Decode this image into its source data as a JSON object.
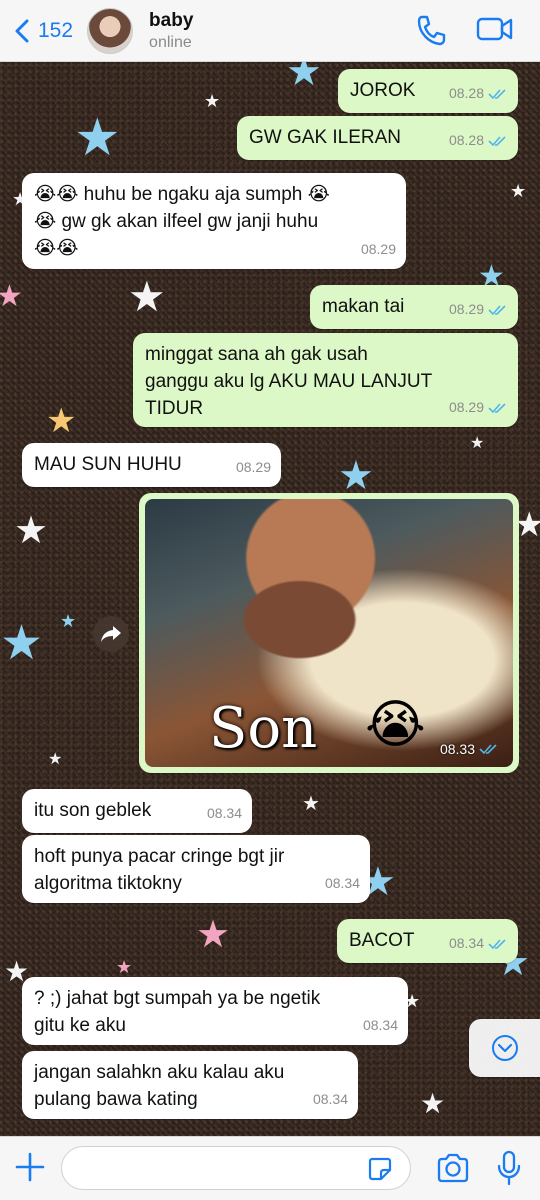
{
  "header": {
    "back_count": "152",
    "contact_name": "baby",
    "contact_status": "online"
  },
  "colors": {
    "accent": "#1a7cf0",
    "outgoing_bubble": "#dcf8c6",
    "incoming_bubble": "#ffffff",
    "read_ticks": "#4fb6ec"
  },
  "messages": [
    {
      "dir": "out",
      "text": "JOROK",
      "time": "08.28",
      "read": true
    },
    {
      "dir": "out",
      "text": "GW GAK ILERAN",
      "time": "08.28",
      "read": true
    },
    {
      "dir": "in",
      "text": "😭😭 huhu be ngaku aja sumph 😭\n😭 gw gk akan ilfeel gw janji huhu\n😭😭",
      "time": "08.29"
    },
    {
      "dir": "out",
      "text": "makan tai",
      "time": "08.29",
      "read": true
    },
    {
      "dir": "out",
      "text": "minggat sana ah gak usah\nganggu aku lg AKU MAU LANJUT\nTIDUR",
      "time": "08.29",
      "read": true
    },
    {
      "dir": "in",
      "text": "MAU SUN HUHU",
      "time": "08.29"
    },
    {
      "dir": "out",
      "type": "image",
      "caption_text": "Son",
      "emoji": "😭",
      "time": "08.33",
      "read": true
    },
    {
      "dir": "in",
      "text": "itu son geblek",
      "time": "08.34"
    },
    {
      "dir": "in",
      "text": "hoft punya pacar cringe bgt jir\nalgoritma tiktokny",
      "time": "08.34"
    },
    {
      "dir": "out",
      "text": "BACOT",
      "time": "08.34",
      "read": true
    },
    {
      "dir": "in",
      "text": "? ;) jahat bgt sumpah ya be ngetik\ngitu ke aku",
      "time": "08.34"
    },
    {
      "dir": "in",
      "text": "jangan salahkn aku kalau aku\npulang bawa kating",
      "time": "08.34"
    }
  ],
  "footer": {
    "input_value": "",
    "input_placeholder": ""
  }
}
